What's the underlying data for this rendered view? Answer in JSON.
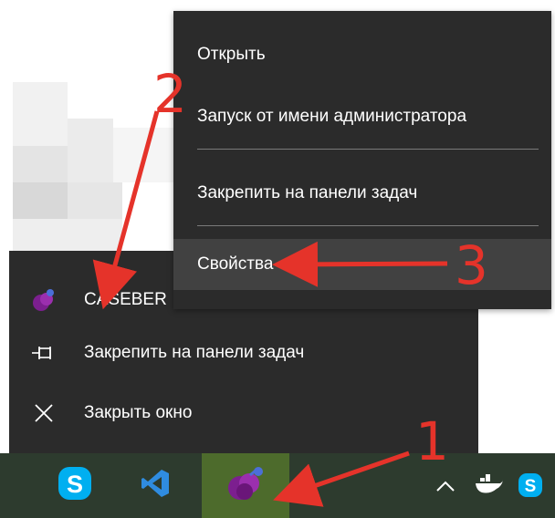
{
  "context_menu": {
    "items": [
      {
        "label": "Открыть"
      },
      {
        "label": "Запуск от имени администратора"
      },
      {
        "label": "Закрепить на панели задач"
      },
      {
        "label": "Свойства"
      }
    ]
  },
  "jump_list": {
    "app_title": "CASEBER",
    "pin_label": "Закрепить на панели задач",
    "close_label": "Закрыть окно"
  },
  "annotations": {
    "step1": "1",
    "step2": "2",
    "step3": "3"
  },
  "colors": {
    "menu_bg": "#2b2b2b",
    "taskbar_bg": "#2d3b2e",
    "active_taskbar": "#4d6b2c",
    "annotation_red": "#e5332a",
    "skype_blue": "#00aff0",
    "vscode_blue": "#2f8ce0",
    "app_purple": "#8a1f9c"
  },
  "icons": {
    "skype": "skype-icon",
    "vscode": "vscode-icon",
    "app": "caseberry-icon",
    "tray_chevron": "chevron-up-icon",
    "docker": "docker-icon",
    "tray_skype": "skype-tray-icon",
    "pin": "pin-icon",
    "close": "close-icon"
  }
}
